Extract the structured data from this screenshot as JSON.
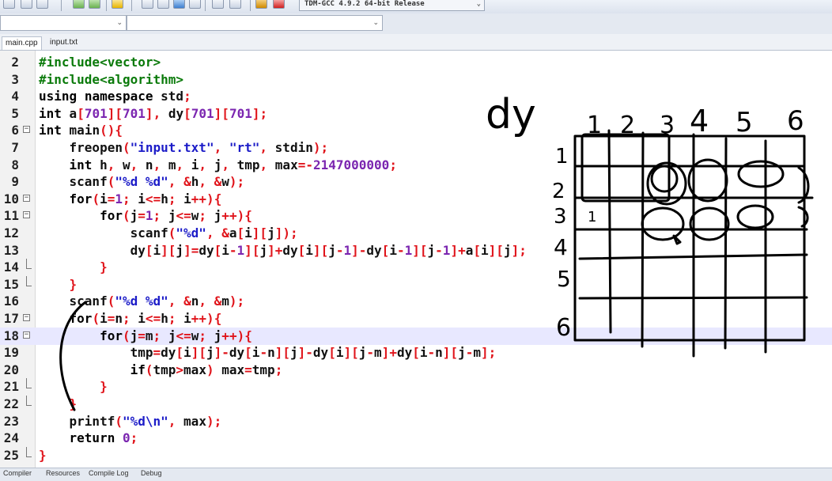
{
  "toolbar": {
    "compiler": "TDM-GCC 4.9.2 64-bit Release",
    "icons": [
      "find-icon",
      "save-icon",
      "save-all-icon",
      "compile-icon",
      "run-icon",
      "debug-icon",
      "grid-icon",
      "window-icon",
      "chart-icon",
      "layout-icon",
      "check-icon",
      "close-icon",
      "profile-icon",
      "stop-icon"
    ]
  },
  "tabs": [
    {
      "label": "main.cpp",
      "active": true
    },
    {
      "label": "input.txt",
      "active": false
    }
  ],
  "editor": {
    "lines": [
      {
        "n": "2",
        "fold": ""
      },
      {
        "n": "3",
        "fold": ""
      },
      {
        "n": "4",
        "fold": ""
      },
      {
        "n": "5",
        "fold": ""
      },
      {
        "n": "6",
        "fold": "open"
      },
      {
        "n": "7",
        "fold": ""
      },
      {
        "n": "8",
        "fold": ""
      },
      {
        "n": "9",
        "fold": ""
      },
      {
        "n": "10",
        "fold": "open"
      },
      {
        "n": "11",
        "fold": "open"
      },
      {
        "n": "12",
        "fold": ""
      },
      {
        "n": "13",
        "fold": ""
      },
      {
        "n": "14",
        "fold": "end"
      },
      {
        "n": "15",
        "fold": "end"
      },
      {
        "n": "16",
        "fold": ""
      },
      {
        "n": "17",
        "fold": "open"
      },
      {
        "n": "18",
        "fold": "open"
      },
      {
        "n": "19",
        "fold": ""
      },
      {
        "n": "20",
        "fold": ""
      },
      {
        "n": "21",
        "fold": "end"
      },
      {
        "n": "22",
        "fold": "end"
      },
      {
        "n": "23",
        "fold": ""
      },
      {
        "n": "24",
        "fold": ""
      },
      {
        "n": "25",
        "fold": "close"
      }
    ],
    "code": [
      "#include<vector>",
      "#include<algorithm>",
      "using namespace std;",
      "int a[701][701], dy[701][701];",
      "int main(){",
      "    freopen(\"input.txt\", \"rt\", stdin);",
      "    int h, w, n, m, i, j, tmp, max=-2147000000;",
      "    scanf(\"%d %d\", &h, &w);",
      "    for(i=1; i<=h; i++){",
      "        for(j=1; j<=w; j++){",
      "            scanf(\"%d\", &a[i][j]);",
      "            dy[i][j]=dy[i-1][j]+dy[i][j-1]-dy[i-1][j-1]+a[i][j];",
      "        }",
      "    }",
      "    scanf(\"%d %d\", &n, &m);",
      "    for(i=n; i<=h; i++){",
      "        for(j=m; j<=w; j++){",
      "            tmp=dy[i][j]-dy[i-n][j]-dy[i][j-m]+dy[i-n][j-m];",
      "            if(tmp>max) max=tmp;",
      "        }",
      "    }",
      "    printf(\"%d\\n\", max);",
      "    return 0;",
      "}"
    ],
    "current_line": "18"
  },
  "annotation": {
    "title": "dy",
    "col_labels": [
      "1",
      "2",
      "3",
      "4",
      "5",
      "6"
    ],
    "row_labels": [
      "1",
      "2",
      "3",
      "4",
      "5",
      "6"
    ],
    "inner_mark": "1"
  },
  "statusbar": {
    "items": [
      "Compiler",
      "Resources",
      "Compile Log",
      "Debug"
    ]
  }
}
